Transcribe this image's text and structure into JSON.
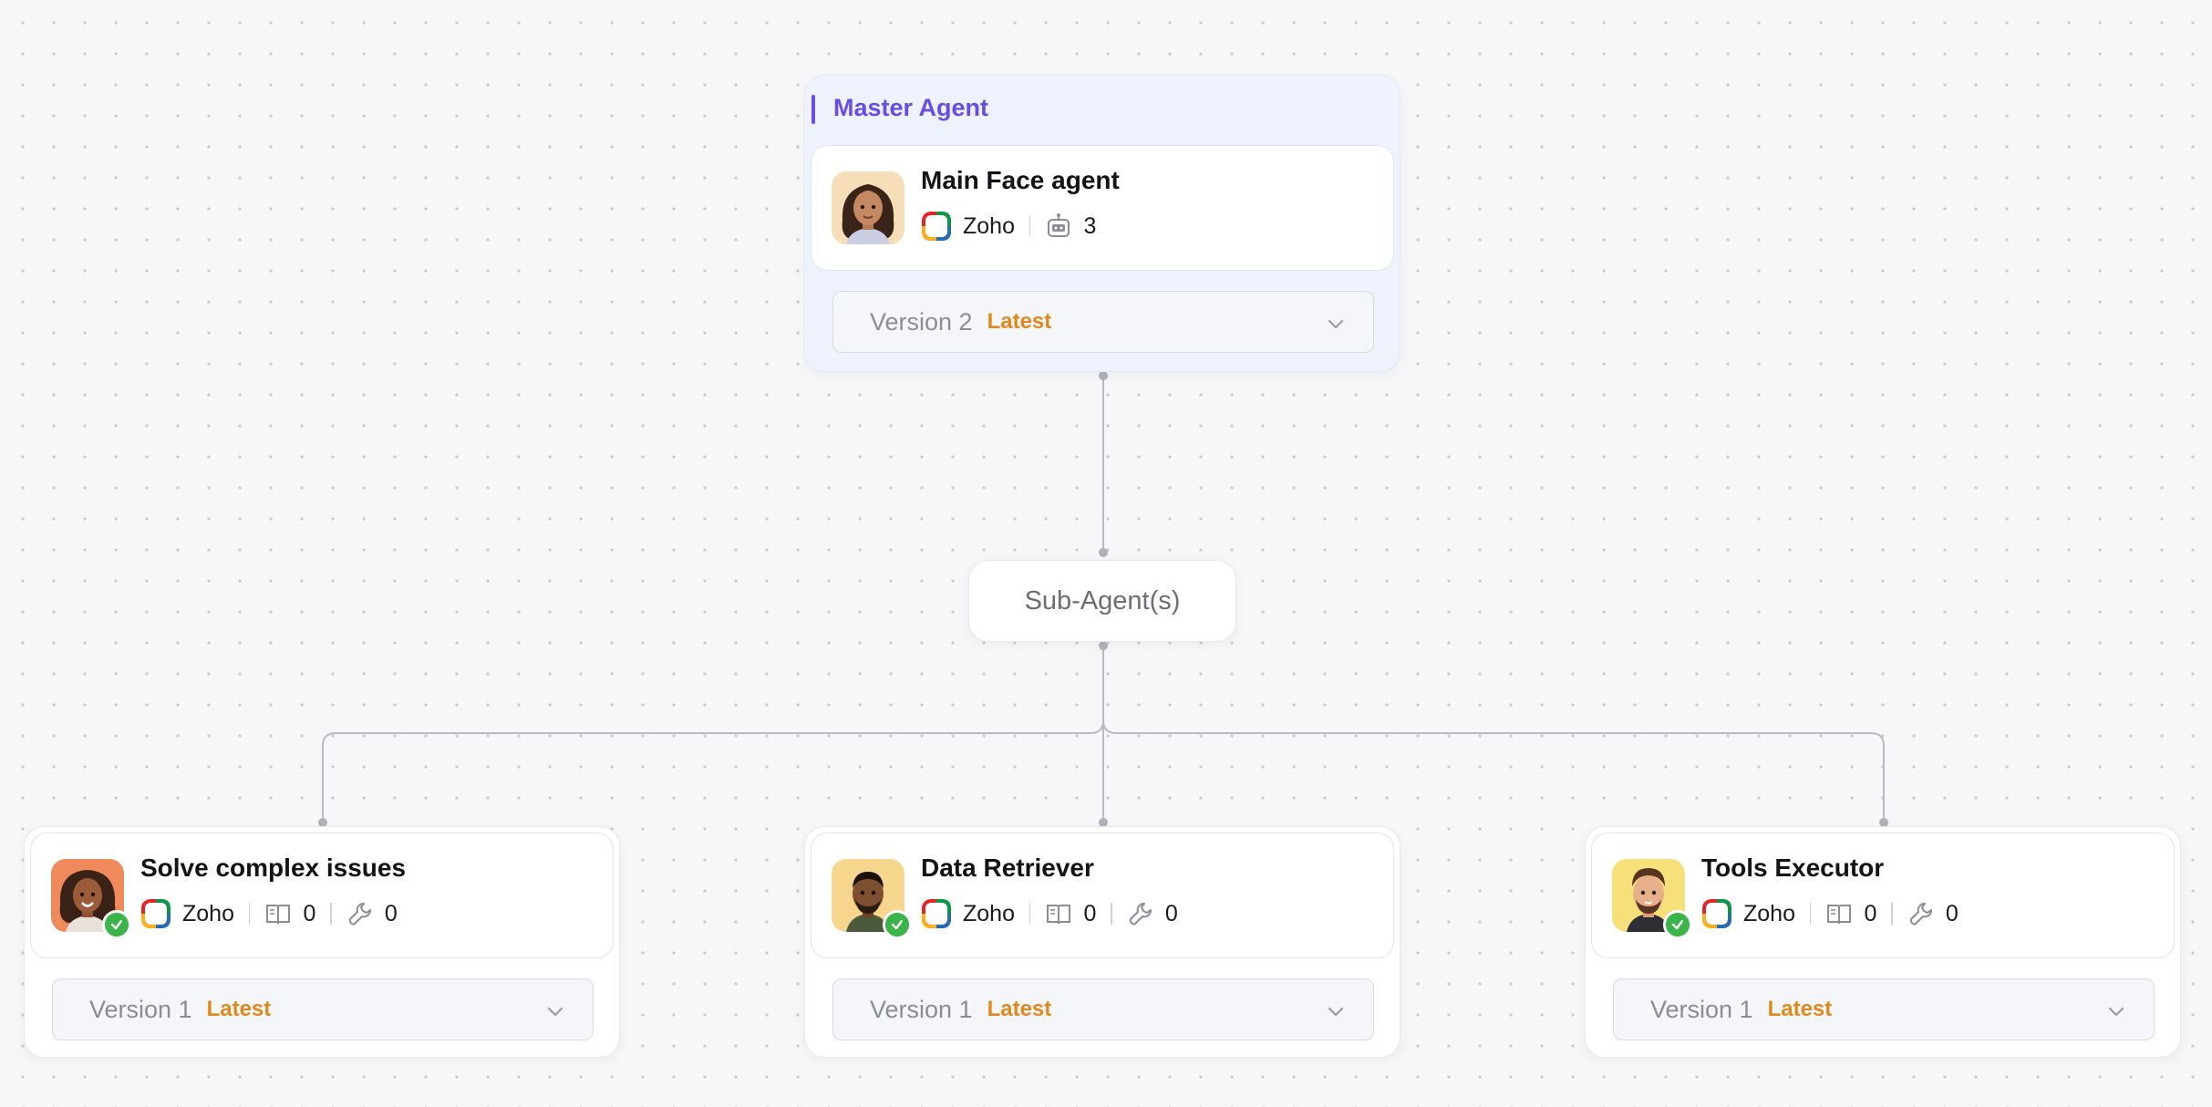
{
  "master": {
    "section_label": "Master Agent",
    "name": "Main Face agent",
    "platform": "Zoho",
    "bot_count": "3",
    "version": "Version 2",
    "version_tag": "Latest"
  },
  "bridge": {
    "label": "Sub-Agent(s)"
  },
  "sub_agents": [
    {
      "name": "Solve complex issues",
      "platform": "Zoho",
      "knowledge_count": "0",
      "tools_count": "0",
      "version": "Version 1",
      "version_tag": "Latest"
    },
    {
      "name": "Data Retriever",
      "platform": "Zoho",
      "knowledge_count": "0",
      "tools_count": "0",
      "version": "Version 1",
      "version_tag": "Latest"
    },
    {
      "name": "Tools Executor",
      "platform": "Zoho",
      "knowledge_count": "0",
      "tools_count": "0",
      "version": "Version 1",
      "version_tag": "Latest"
    }
  ],
  "icons": {
    "platform": "zoho-logo-icon",
    "bots": "robot-icon",
    "knowledge": "book-icon",
    "tools": "wrench-icon",
    "dropdown": "chevron-down-icon",
    "status": "check-badge-icon"
  },
  "colors": {
    "accent": "#6a4de8",
    "latest": "#e08a1e",
    "status_ok": "#3bb54a",
    "connector": "#b9bbc2"
  }
}
